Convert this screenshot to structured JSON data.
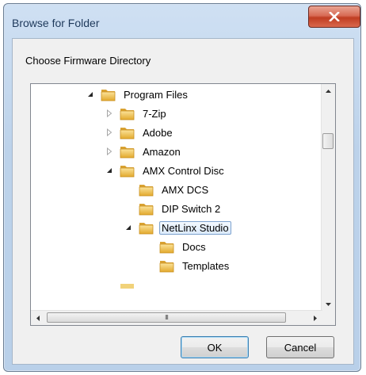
{
  "dialog": {
    "title": "Browse for Folder",
    "prompt": "Choose Firmware Directory"
  },
  "tree": {
    "items": [
      {
        "label": "Program Files",
        "expander": "expanded",
        "selected": false
      },
      {
        "label": "7-Zip",
        "expander": "collapsed",
        "selected": false
      },
      {
        "label": "Adobe",
        "expander": "collapsed",
        "selected": false
      },
      {
        "label": "Amazon",
        "expander": "collapsed",
        "selected": false
      },
      {
        "label": "AMX Control Disc",
        "expander": "expanded",
        "selected": false
      },
      {
        "label": "AMX DCS",
        "expander": "none",
        "selected": false
      },
      {
        "label": "DIP Switch 2",
        "expander": "none",
        "selected": false
      },
      {
        "label": "NetLinx Studio",
        "expander": "expanded",
        "selected": true
      },
      {
        "label": "Docs",
        "expander": "none",
        "selected": false
      },
      {
        "label": "Templates",
        "expander": "none",
        "selected": false
      }
    ],
    "hscroll_grip": "III"
  },
  "buttons": {
    "ok": "OK",
    "cancel": "Cancel"
  },
  "icons": {
    "close": "close-icon",
    "folder": "folder-icon",
    "expanded": "triangle-expanded-icon",
    "collapsed": "triangle-collapsed-icon"
  },
  "colors": {
    "close_button": "#c73f24",
    "selection_border": "#7da2ce",
    "folder": "#e8b63a"
  }
}
